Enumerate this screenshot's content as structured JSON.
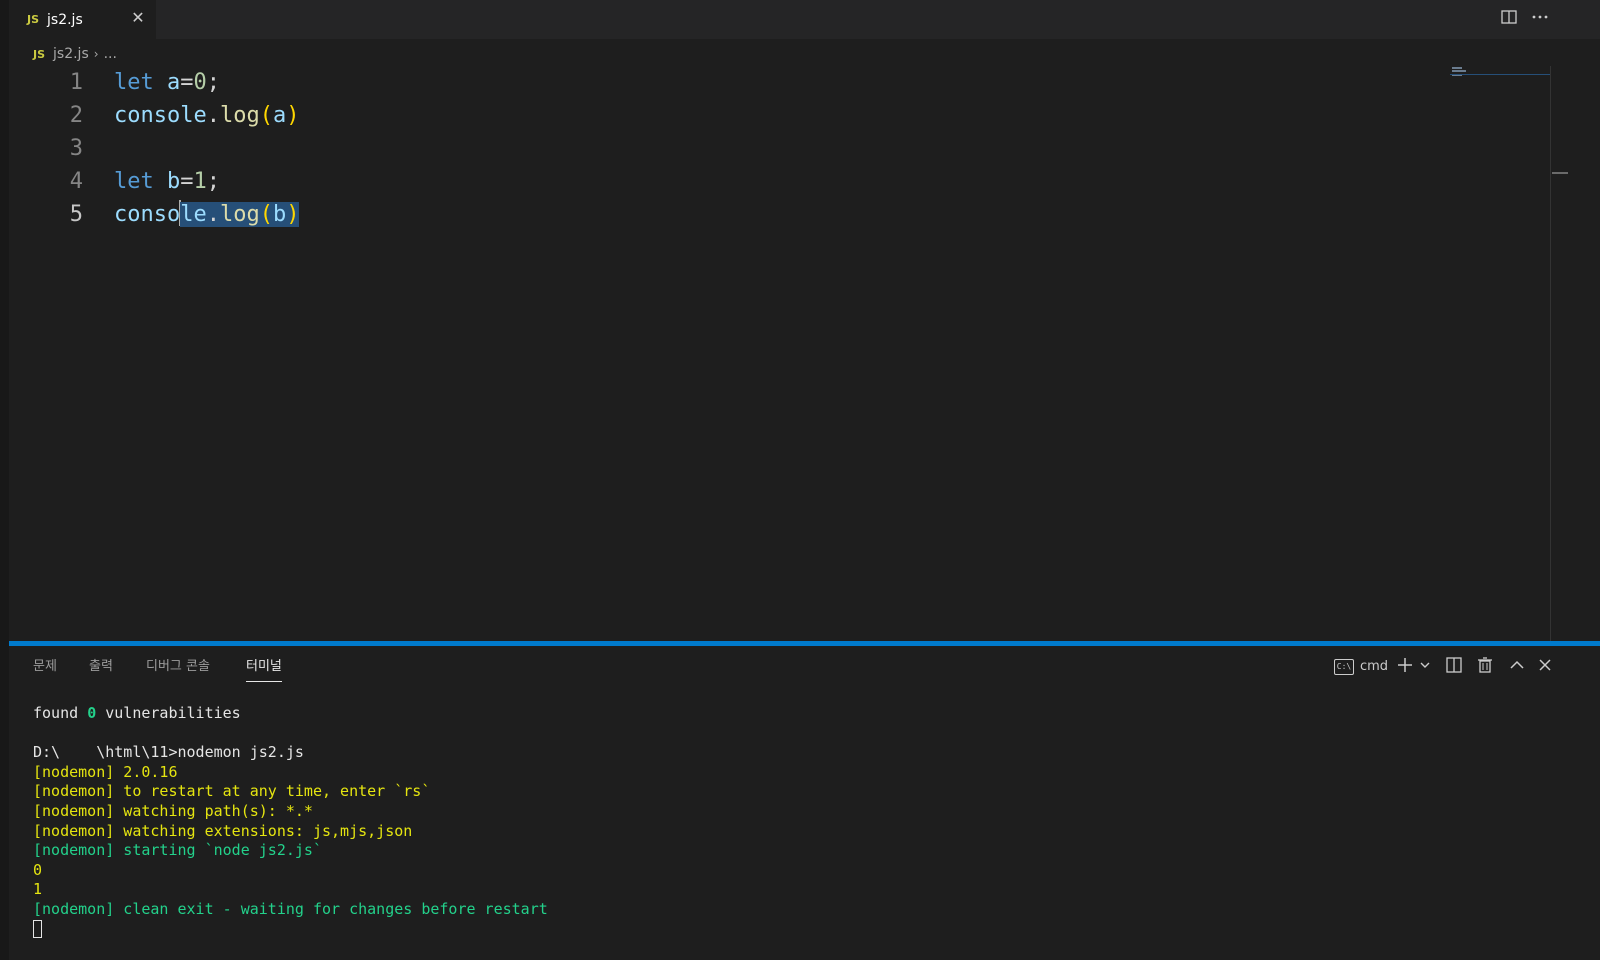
{
  "tab": {
    "badge": "JS",
    "title": "js2.js",
    "close": "✕"
  },
  "toolbar": {
    "split_icon": "split-editor-icon",
    "more_icon": "more-actions-icon"
  },
  "breadcrumb": {
    "badge": "JS",
    "file": "js2.js",
    "sep": "›",
    "rest": "..."
  },
  "editor": {
    "lines": [
      {
        "num": "1",
        "tokens": [
          [
            "let",
            "kw"
          ],
          [
            " ",
            ""
          ],
          [
            "a",
            "var"
          ],
          [
            "=",
            ""
          ],
          [
            "0",
            "num"
          ],
          [
            ";",
            ""
          ]
        ]
      },
      {
        "num": "2",
        "tokens": [
          [
            "console",
            "var"
          ],
          [
            ".",
            ""
          ],
          [
            "log",
            "fn"
          ],
          [
            "(",
            "paren"
          ],
          [
            "a",
            "var"
          ],
          [
            ")",
            "paren"
          ]
        ]
      },
      {
        "num": "3",
        "tokens": []
      },
      {
        "num": "4",
        "tokens": [
          [
            "let",
            "kw"
          ],
          [
            " ",
            ""
          ],
          [
            "b",
            "var"
          ],
          [
            "=",
            ""
          ],
          [
            "1",
            "num"
          ],
          [
            ";",
            ""
          ]
        ]
      },
      {
        "num": "5",
        "pre": "conso",
        "selected": "le.log(b)"
      }
    ],
    "selected_line": {
      "pre": "conso",
      "sel_parts": [
        [
          "le",
          "var"
        ],
        [
          ".",
          ""
        ],
        [
          "log",
          "fn"
        ],
        [
          "(",
          "paren"
        ],
        [
          "b",
          "var"
        ],
        [
          ")",
          "paren"
        ]
      ]
    }
  },
  "panel": {
    "tabs": [
      "문제",
      "출력",
      "디버그 콘솔",
      "터미널"
    ],
    "active_tab": 3,
    "shell": {
      "icon_text": "C:\\",
      "label": "cmd"
    },
    "icons": [
      "add-terminal-icon",
      "dropdown-chevron-icon",
      "split-terminal-icon",
      "trash-icon",
      "maximize-panel-icon",
      "close-panel-icon"
    ]
  },
  "terminal": {
    "lines": [
      {
        "parts": [
          [
            "found ",
            "white"
          ],
          [
            "0",
            "green-bold"
          ],
          [
            " vulnerabilities",
            "white"
          ]
        ]
      },
      {
        "parts": [
          [
            "",
            "white"
          ]
        ]
      },
      {
        "parts": [
          [
            "D:\\    \\html\\11>nodemon js2.js",
            "white"
          ]
        ]
      },
      {
        "parts": [
          [
            "[nodemon] 2.0.16",
            "yellow"
          ]
        ]
      },
      {
        "parts": [
          [
            "[nodemon] to restart at any time, enter `rs`",
            "yellow"
          ]
        ]
      },
      {
        "parts": [
          [
            "[nodemon] watching path(s): *.*",
            "yellow"
          ]
        ]
      },
      {
        "parts": [
          [
            "[nodemon] watching extensions: js,mjs,json",
            "yellow"
          ]
        ]
      },
      {
        "parts": [
          [
            "[nodemon] starting `node js2.js`",
            "green"
          ]
        ]
      },
      {
        "parts": [
          [
            "0",
            "yellow"
          ]
        ]
      },
      {
        "parts": [
          [
            "1",
            "yellow"
          ]
        ]
      },
      {
        "parts": [
          [
            "[nodemon] clean exit - waiting for changes before restart",
            "green"
          ]
        ]
      }
    ]
  },
  "colors": {
    "accent": "#007acc",
    "selection": "#264f78",
    "background": "#1e1e1e"
  }
}
